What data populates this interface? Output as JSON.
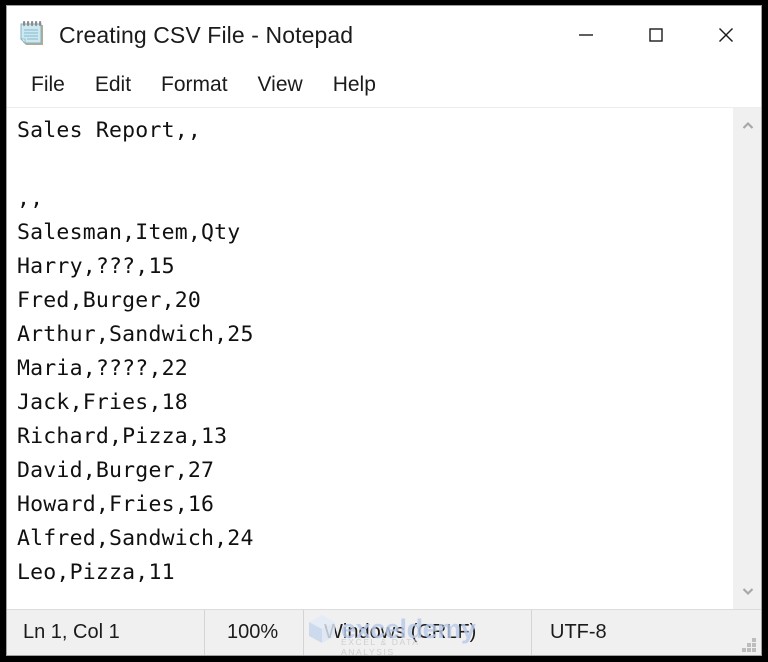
{
  "window": {
    "title": "Creating CSV File - Notepad",
    "app_icon": "notepad-icon",
    "controls": {
      "minimize": "minimize-icon",
      "maximize": "maximize-icon",
      "close": "close-icon"
    }
  },
  "menubar": {
    "items": [
      {
        "label": "File"
      },
      {
        "label": "Edit"
      },
      {
        "label": "Format"
      },
      {
        "label": "View"
      },
      {
        "label": "Help"
      }
    ]
  },
  "editor": {
    "lines": [
      "Sales Report,,",
      "",
      ",,",
      "Salesman,Item,Qty",
      "Harry,???,15",
      "Fred,Burger,20",
      "Arthur,Sandwich,25",
      "Maria,????,22",
      "Jack,Fries,18",
      "Richard,Pizza,13",
      "David,Burger,27",
      "Howard,Fries,16",
      "Alfred,Sandwich,24",
      "Leo,Pizza,11"
    ]
  },
  "scrollbar": {
    "up_arrow": "chevron-up-icon",
    "down_arrow": "chevron-down-icon"
  },
  "statusbar": {
    "position": "Ln 1, Col 1",
    "zoom": "100%",
    "line_ending": "Windows (CRLF)",
    "encoding": "UTF-8"
  },
  "watermark": {
    "text": "exceldemy",
    "subtext": "EXCEL & DATA ANALYSIS"
  },
  "colors": {
    "window_bg": "#ffffff",
    "status_bg": "#f0f0f0",
    "text": "#101010",
    "watermark": "#b9cbe8",
    "frame": "#000000"
  }
}
